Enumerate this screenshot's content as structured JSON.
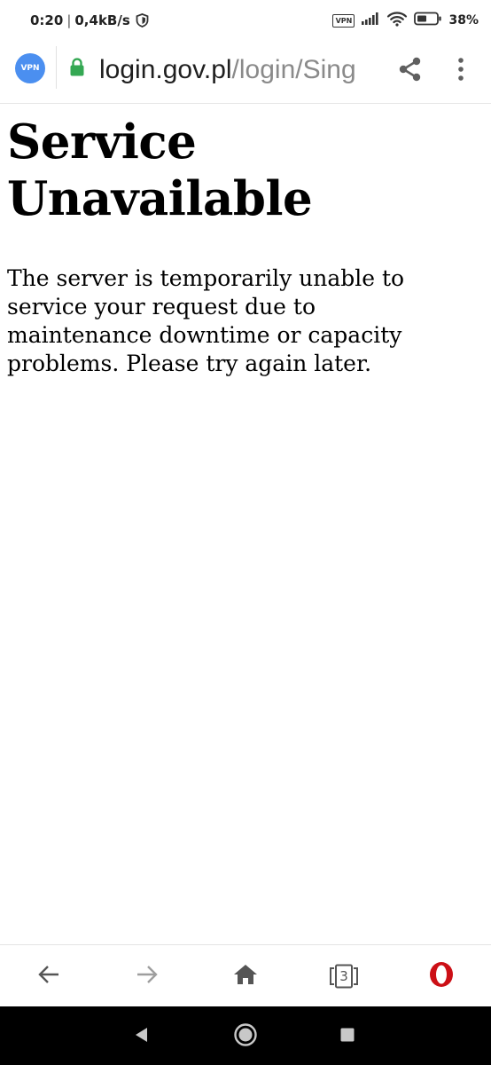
{
  "status_bar": {
    "time": "0:20",
    "separator": "|",
    "network_speed": "0,4kB/s",
    "vpn_label": "VPN",
    "battery_percent": "38%"
  },
  "toolbar": {
    "vpn_button_label": "VPN",
    "url_host": "login.gov.pl",
    "url_path": "/login/Sing",
    "secure": true,
    "accent_color": "#4b8ff0",
    "lock_color": "#34a853"
  },
  "page": {
    "heading": "Service Unavailable",
    "message": "The server is temporarily unable to service your request due to maintenance downtime or capacity problems. Please try again later."
  },
  "bottom_nav": {
    "items": [
      {
        "icon": "back-arrow-icon"
      },
      {
        "icon": "forward-arrow-icon"
      },
      {
        "icon": "home-icon"
      },
      {
        "icon": "tabs-icon"
      },
      {
        "icon": "opera-logo-icon"
      }
    ],
    "tab_count": "3",
    "opera_color": "#cc0f16"
  },
  "system_nav": {
    "items": [
      {
        "icon": "system-back-icon"
      },
      {
        "icon": "system-home-icon"
      },
      {
        "icon": "system-recents-icon"
      }
    ]
  }
}
